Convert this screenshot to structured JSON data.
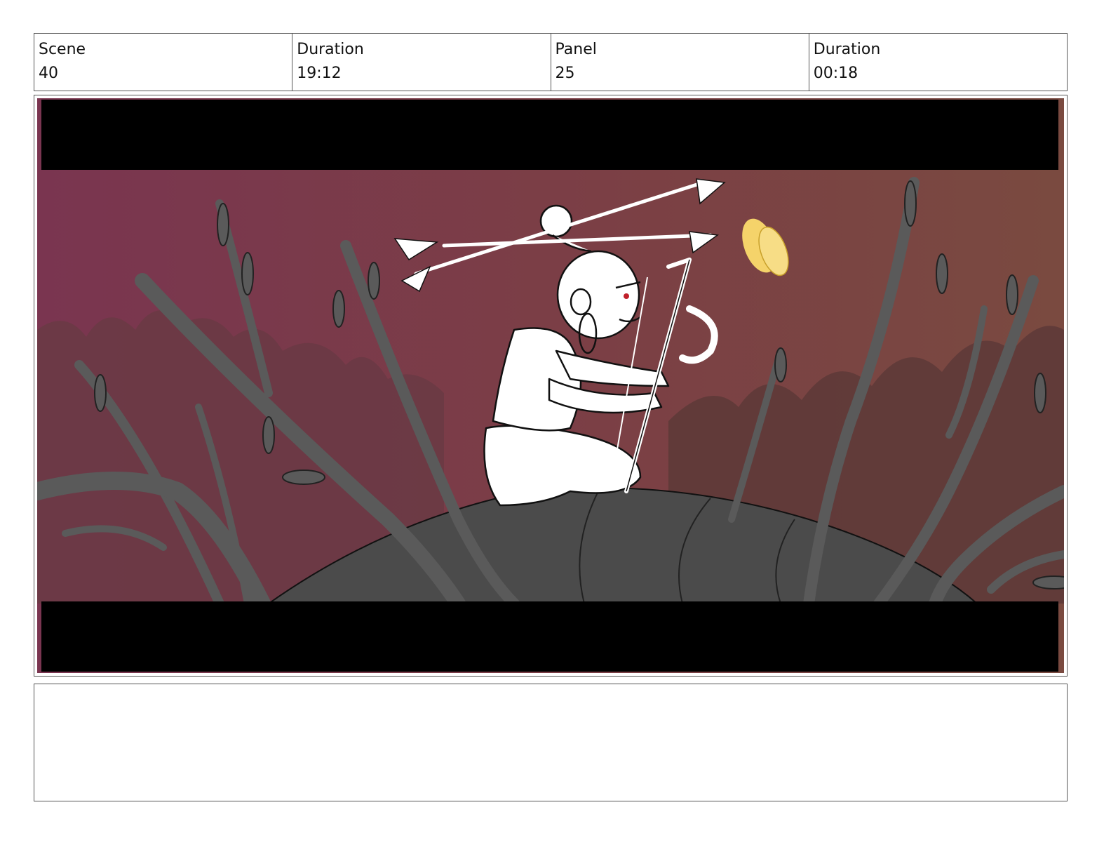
{
  "header": {
    "scene_label": "Scene",
    "scene_value": "40",
    "scene_duration_label": "Duration",
    "scene_duration_value": "19:12",
    "panel_label": "Panel",
    "panel_value": "25",
    "panel_duration_label": "Duration",
    "panel_duration_value": "00:18"
  },
  "panel_art": {
    "subject": "storyboard-drawing",
    "colors": {
      "sky_left": "#7a3550",
      "sky_right": "#7a4a40",
      "hills": "#6a3a44",
      "branches": "#5a5a5a",
      "rock": "#4b4b4b",
      "letterbox": "#000000",
      "figure": "#ffffff",
      "glow": "#f5d36a"
    }
  },
  "notes": {
    "text": ""
  }
}
